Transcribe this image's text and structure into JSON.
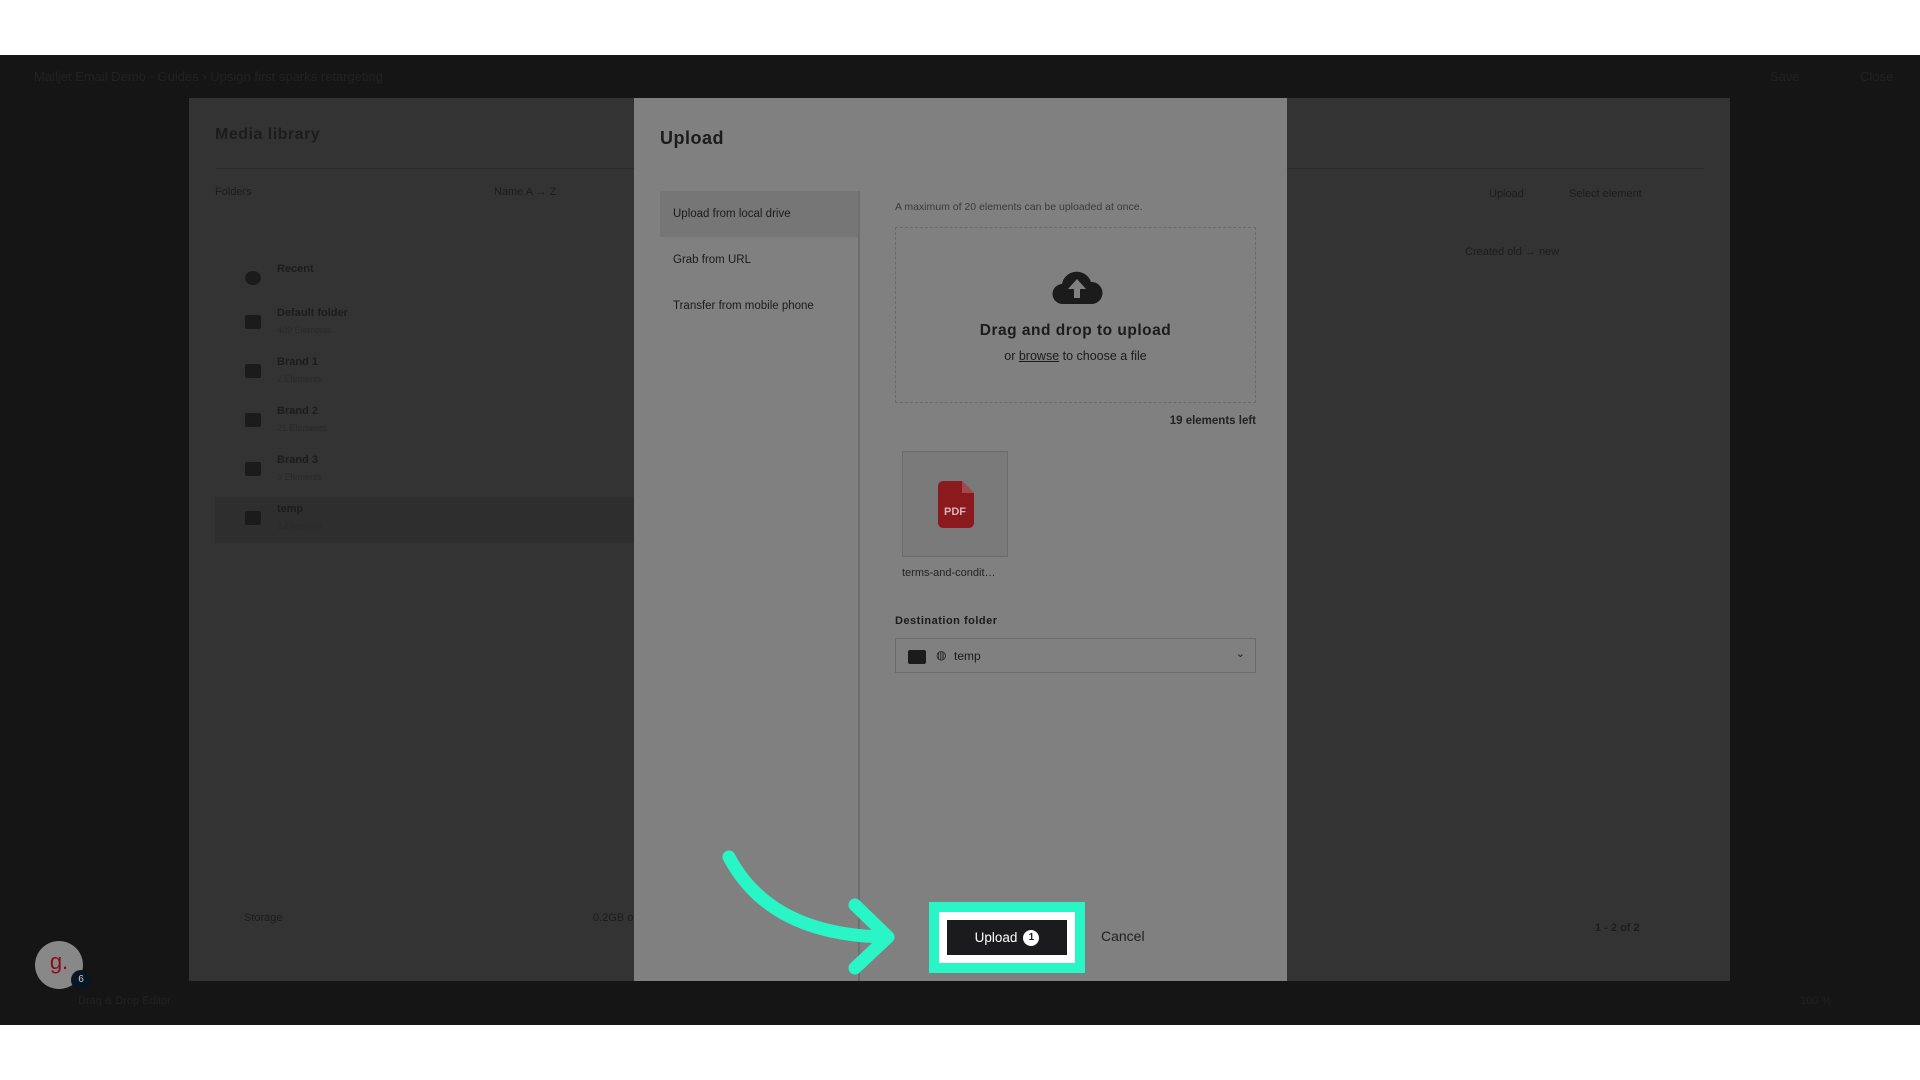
{
  "topbar": {
    "title": "Mailjet Email Demo · Guides › Upsign first sparks retargeting",
    "save": "Save",
    "close": "Close"
  },
  "library": {
    "title": "Media library",
    "folders_label": "Folders",
    "sort": "Name A → Z",
    "upload": "Upload",
    "select": "Select element",
    "sort_right": "Created old → new",
    "folders": [
      {
        "name": "Recent",
        "count": ""
      },
      {
        "name": "Default folder",
        "count": "409 Elements"
      },
      {
        "name": "Brand 1",
        "count": "2 Elements"
      },
      {
        "name": "Brand 2",
        "count": "21 Elements"
      },
      {
        "name": "Brand 3",
        "count": "9 Elements"
      },
      {
        "name": "temp",
        "count": "2 Elements"
      }
    ],
    "storage": "Storage",
    "storage_value": "0.2GB of",
    "pagination": "1 - 2  of  2"
  },
  "bottombar": {
    "editor": "Drag & Drop Editor",
    "zoom": "100 %"
  },
  "modal": {
    "title": "Upload",
    "menu": [
      {
        "label": "Upload from local drive",
        "active": true
      },
      {
        "label": "Grab from URL"
      },
      {
        "label": "Transfer from mobile phone"
      }
    ],
    "info": "A maximum of 20 elements can be uploaded at once.",
    "drop_title": "Drag and drop to upload",
    "drop_or": "or ",
    "drop_browse": "browse",
    "drop_rest": " to choose a file",
    "left": "19 elements left",
    "file": {
      "name": "terms-and-condit…",
      "type": "PDF"
    },
    "dest_label": "Destination folder",
    "dest_value": "temp",
    "upload_label": "Upload",
    "upload_count": "1",
    "cancel": "Cancel"
  },
  "avatar": {
    "letter": "g.",
    "badge": "6"
  },
  "colors": {
    "highlight": "#2af5c6",
    "pdf": "#8b1a1f"
  }
}
